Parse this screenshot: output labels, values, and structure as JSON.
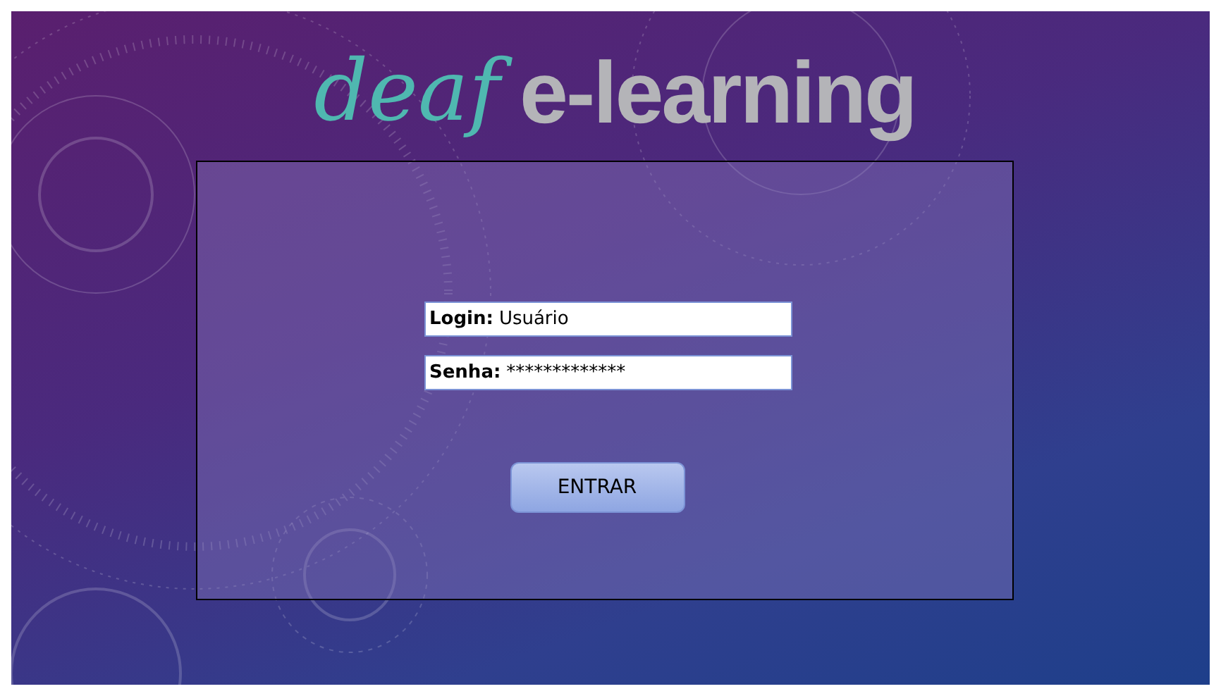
{
  "logo": {
    "script_word": "deaf",
    "word": "e-learning"
  },
  "fields": [
    {
      "label": "Login:",
      "value": "Usuário"
    },
    {
      "label": "Senha:",
      "value": "*************"
    }
  ],
  "button": "ENTRAR"
}
